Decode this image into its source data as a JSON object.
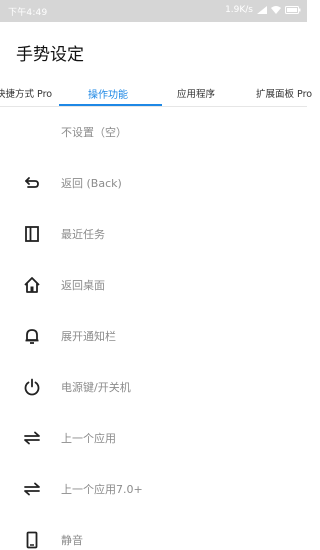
{
  "status_bar": {
    "time": "下午4:49",
    "network_speed": "1.9K/s"
  },
  "page_title": "手势设定",
  "tabs": [
    {
      "label": "快捷方式 Pro"
    },
    {
      "label": "操作功能",
      "selected": true
    },
    {
      "label": "应用程序"
    },
    {
      "label": "扩展面板 Pro"
    }
  ],
  "accent_color": "#1e88e5",
  "actions": [
    {
      "label": "不设置（空）",
      "icon": null
    },
    {
      "label": "返回 (Back)",
      "icon": "back-arrow-icon"
    },
    {
      "label": "最近任务",
      "icon": "recent-tasks-icon"
    },
    {
      "label": "返回桌面",
      "icon": "home-icon"
    },
    {
      "label": "展开通知栏",
      "icon": "notification-bell-icon"
    },
    {
      "label": "电源键/开关机",
      "icon": "power-icon"
    },
    {
      "label": "上一个应用",
      "icon": "switch-app-icon"
    },
    {
      "label": "上一个应用7.0+",
      "icon": "switch-app-icon"
    },
    {
      "label": "静音",
      "icon": "mute-phone-icon"
    }
  ]
}
